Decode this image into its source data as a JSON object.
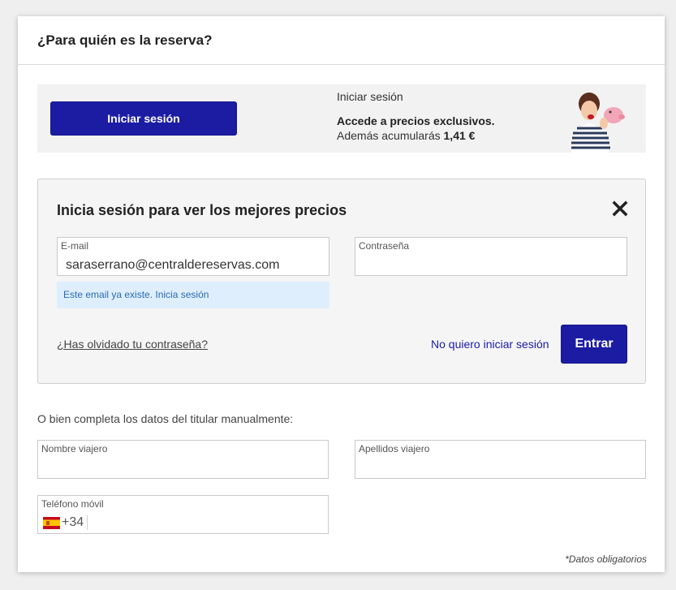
{
  "header": {
    "title": "¿Para quién es la reserva?"
  },
  "promo": {
    "login_button": "Iniciar sesión",
    "small_title": "Iniciar sesión",
    "strong_text": "Accede a precios exclusivos.",
    "accumulate_text": "Además acumularás",
    "amount": "1,41 €",
    "illustration_icon": "woman-with-piggy-bank-illustration"
  },
  "login": {
    "title": "Inicia sesión para ver los mejores precios",
    "close_icon": "close-icon",
    "email_label": "E-mail",
    "email_value": "saraserrano@centraldereservas.com",
    "password_label": "Contraseña",
    "password_value": "",
    "email_hint": "Este email ya existe. Inicia sesión",
    "forgot_link": "¿Has olvidado tu contraseña?",
    "no_login_link": "No quiero iniciar sesión",
    "enter_button": "Entrar"
  },
  "manual": {
    "label": "O bien completa los datos del titular manualmente:",
    "first_name_label": "Nombre viajero",
    "first_name_value": "",
    "last_name_label": "Apellidos viajero",
    "last_name_value": "",
    "phone_label": "Teléfono móvil",
    "phone_prefix": "+34",
    "phone_flag_icon": "spain-flag-icon",
    "phone_value": ""
  },
  "footer": {
    "required_note": "*Datos obligatorios"
  },
  "colors": {
    "primary": "#1c1ca3",
    "hint_background": "#dfeefd",
    "hint_text": "#2a6ab0",
    "panel_background": "#f5f5f5"
  }
}
